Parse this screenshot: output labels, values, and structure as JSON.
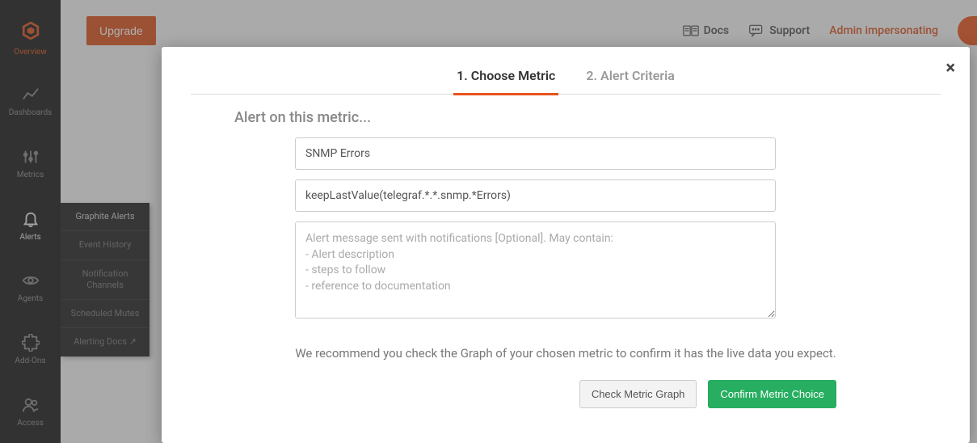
{
  "sidebar": {
    "items": [
      {
        "label": "Overview"
      },
      {
        "label": "Dashboards"
      },
      {
        "label": "Metrics"
      },
      {
        "label": "Alerts"
      },
      {
        "label": "Agents"
      },
      {
        "label": "Add-Ons"
      },
      {
        "label": "Access"
      }
    ]
  },
  "submenu": {
    "items": [
      {
        "label": "Graphite Alerts"
      },
      {
        "label": "Event History"
      },
      {
        "label": "Notification Channels"
      },
      {
        "label": "Scheduled Mutes"
      },
      {
        "label": "Alerting Docs ↗"
      }
    ]
  },
  "topbar": {
    "upgrade": "Upgrade",
    "docs": "Docs",
    "support": "Support",
    "impersonating": "Admin impersonating"
  },
  "modal": {
    "close": "×",
    "tabs": [
      {
        "label": "1. Choose Metric"
      },
      {
        "label": "2. Alert Criteria"
      }
    ],
    "section_title": "Alert on this metric...",
    "name_value": "SNMP Errors",
    "metric_value": "keepLastValue(telegraf.*.*.snmp.*Errors)",
    "message_placeholder": "Alert message sent with notifications [Optional]. May contain:\n- Alert description\n- steps to follow\n- reference to documentation",
    "recommend": "We recommend you check the Graph of your chosen metric to confirm it has the live data you expect.",
    "check_btn": "Check Metric Graph",
    "confirm_btn": "Confirm Metric Choice"
  }
}
